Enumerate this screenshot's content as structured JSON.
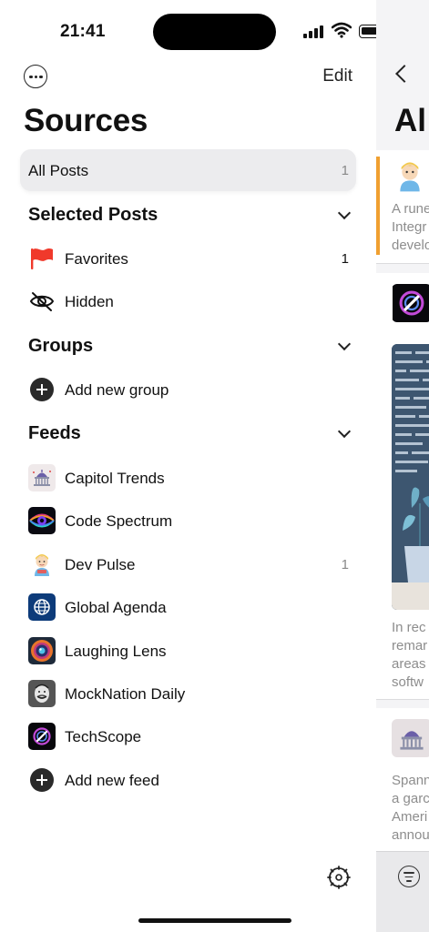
{
  "status_bar": {
    "time": "21:41"
  },
  "header": {
    "edit_label": "Edit",
    "title": "Sources"
  },
  "all_posts": {
    "label": "All Posts",
    "count": "1"
  },
  "sections": {
    "selected_posts": {
      "title": "Selected Posts",
      "items": [
        {
          "label": "Favorites",
          "count": "1",
          "icon": "red-flag-icon"
        },
        {
          "label": "Hidden",
          "count": "",
          "icon": "eye-slash-icon"
        }
      ]
    },
    "groups": {
      "title": "Groups",
      "add_label": "Add new group"
    },
    "feeds": {
      "title": "Feeds",
      "items": [
        {
          "label": "Capitol Trends",
          "count": "",
          "icon": "capitol-building-icon"
        },
        {
          "label": "Code Spectrum",
          "count": "",
          "icon": "spectrum-eye-icon"
        },
        {
          "label": "Dev Pulse",
          "count": "1",
          "icon": "developer-avatar-icon"
        },
        {
          "label": "Global Agenda",
          "count": "",
          "icon": "globe-icon"
        },
        {
          "label": "Laughing Lens",
          "count": "",
          "icon": "camera-lens-icon"
        },
        {
          "label": "MockNation Daily",
          "count": "",
          "icon": "face-portrait-icon"
        },
        {
          "label": "TechScope",
          "count": "",
          "icon": "techscope-logo-icon"
        }
      ],
      "add_label": "Add new feed"
    }
  },
  "detail_pane": {
    "title_fragment": "Al",
    "posts": [
      {
        "lines": [
          "A rune",
          "Integr",
          "develo"
        ]
      },
      {
        "lines": [
          "In rec",
          "remar",
          "areas",
          "softw"
        ]
      },
      {
        "lines": [
          "Spann",
          "a garc",
          "Ameri",
          "annou"
        ]
      }
    ]
  },
  "colors": {
    "accent_orange": "#f0a030",
    "flag_red": "#f0392b",
    "all_posts_bg": "#ececee"
  }
}
